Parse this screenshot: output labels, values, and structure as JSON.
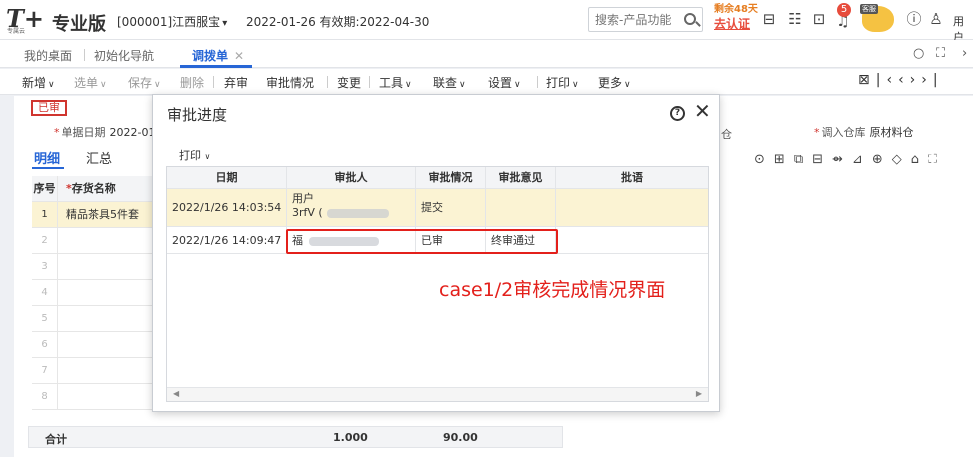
{
  "app": {
    "logo_text": "T+",
    "logo_sub": "专属云",
    "edition": "专业版",
    "account": "[000001]江西服宝",
    "date_info": "2022-01-26 有效期:2022-04-30",
    "search_placeholder": "搜索-产品功能",
    "trial_days": "剩余48天",
    "certify": "去认证",
    "notif_count": "5",
    "mascot_label": "客服",
    "user_label": "用户"
  },
  "tabs": [
    {
      "label": "我的桌面"
    },
    {
      "label": "初始化导航"
    },
    {
      "label": "调拨单",
      "active": true
    }
  ],
  "toolbar": {
    "items": [
      "新增",
      "选单",
      "保存",
      "删除",
      "弃审",
      "审批情况",
      "变更",
      "工具",
      "联查",
      "设置",
      "打印",
      "更多"
    ]
  },
  "document": {
    "status": "已审",
    "date_label": "单据日期",
    "date_value": "2022-01",
    "inbound_label": "调入仓库",
    "inbound_value": "原材料仓",
    "left_fragment": "仓",
    "subtabs": [
      "明细",
      "汇总"
    ],
    "grid_headers": {
      "no": "序号",
      "name": "存货名称"
    },
    "rows": [
      {
        "no": "1",
        "name": "精品茶具5件套"
      },
      {
        "no": "2",
        "name": ""
      },
      {
        "no": "3",
        "name": ""
      },
      {
        "no": "4",
        "name": ""
      },
      {
        "no": "5",
        "name": ""
      },
      {
        "no": "6",
        "name": ""
      },
      {
        "no": "7",
        "name": ""
      },
      {
        "no": "8",
        "name": ""
      }
    ],
    "totals": {
      "label": "合计",
      "qty": "1.000",
      "amount": "90.00"
    }
  },
  "modal": {
    "title": "审批进度",
    "print": "打印",
    "headers": [
      "日期",
      "审批人",
      "审批情况",
      "审批意见",
      "批语"
    ],
    "rows": [
      {
        "date": "2022/1/26 14:03:54",
        "approver_line1": "用户",
        "approver_line2": "3rfV  (",
        "status": "提交",
        "opinion": "",
        "comment": ""
      },
      {
        "date": "2022/1/26 14:09:47",
        "approver_line1": "福",
        "status": "已审",
        "opinion": "终审通过",
        "comment": ""
      }
    ]
  },
  "annotation": "case1/2审核完成情况界面",
  "colors": {
    "accent": "#2766d6",
    "annotation": "#e3201b",
    "selected_row": "#fbf3d3"
  }
}
